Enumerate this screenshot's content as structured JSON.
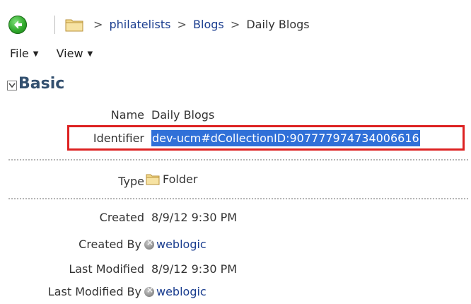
{
  "breadcrumb": {
    "items": [
      "philatelists",
      "Blogs",
      "Daily Blogs"
    ],
    "separator": ">"
  },
  "menu": {
    "file": "File",
    "view": "View"
  },
  "section": {
    "title": "Basic"
  },
  "fields": {
    "name_label": "Name",
    "name_value": "Daily Blogs",
    "identifier_label": "Identifier",
    "identifier_value": "dev-ucm#dCollectionID:907777974734006616",
    "type_label": "Type",
    "type_value": "Folder",
    "created_label": "Created",
    "created_value": "8/9/12 9:30 PM",
    "created_by_label": "Created By",
    "created_by_value": "weblogic",
    "last_modified_label": "Last Modified",
    "last_modified_value": "8/9/12 9:30 PM",
    "last_modified_by_label": "Last Modified By",
    "last_modified_by_value": "weblogic"
  },
  "colors": {
    "link": "#1a3d8f",
    "highlight_border": "#dd2222",
    "selection": "#3070d8",
    "back_button": "#2fa82a"
  },
  "icons": {
    "back": "back-arrow-icon",
    "folder": "folder-icon",
    "user": "user-icon",
    "collapse": "chevron-down-icon"
  }
}
